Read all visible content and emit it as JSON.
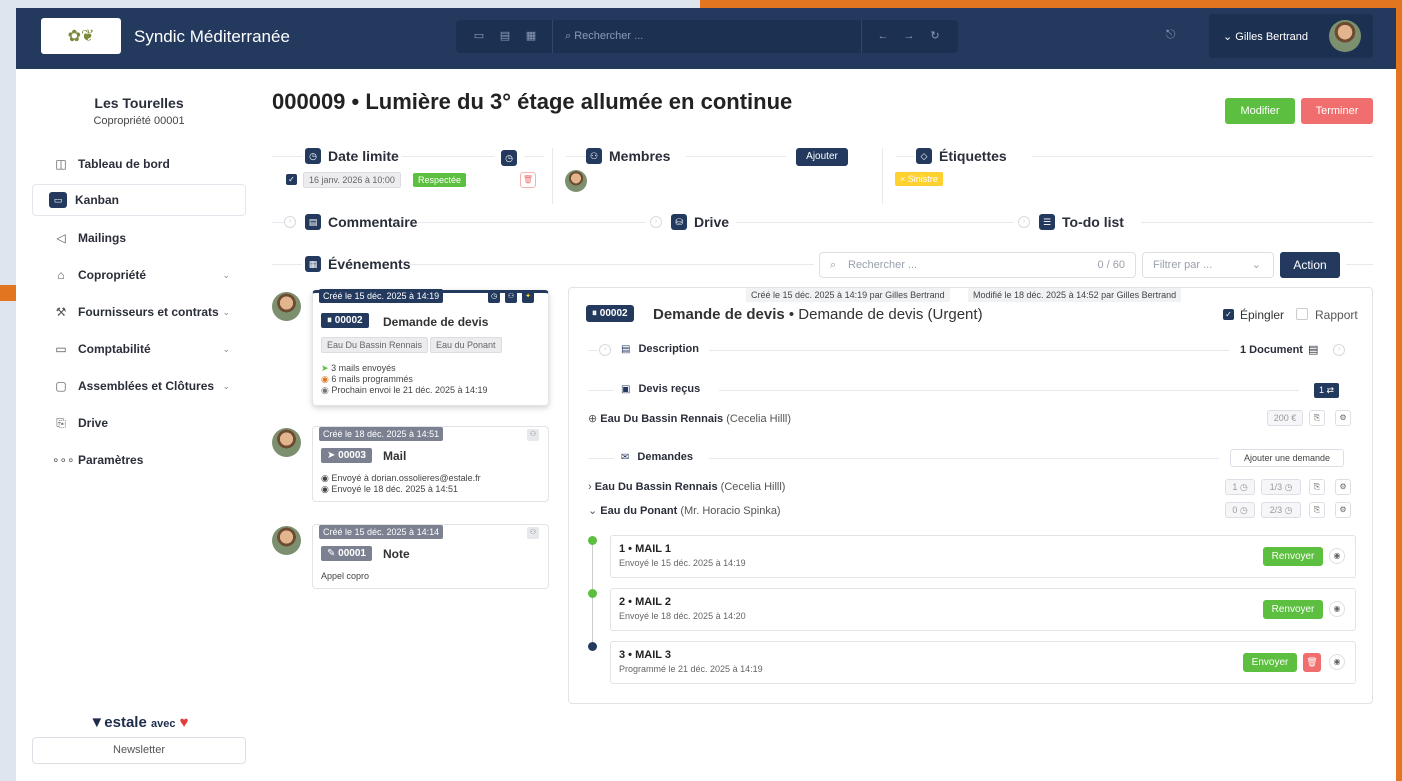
{
  "app": {
    "title": "Syndic Méditerranée",
    "search_placeholder": "Rechercher ...",
    "user_name": "Gilles Bertrand"
  },
  "sidebar": {
    "org_name": "Les Tourelles",
    "org_sub": "Copropriété 00001",
    "items": [
      {
        "label": "Tableau de bord"
      },
      {
        "label": "Kanban"
      },
      {
        "label": "Mailings"
      },
      {
        "label": "Copropriété"
      },
      {
        "label": "Fournisseurs et contrats"
      },
      {
        "label": "Comptabilité"
      },
      {
        "label": "Assemblées et Clôtures"
      },
      {
        "label": "Drive"
      },
      {
        "label": "Paramètres"
      }
    ],
    "brand": "estale",
    "brand_suffix": "avec",
    "newsletter": "Newsletter"
  },
  "page": {
    "title": "000009 • Lumière du 3° étage allumée en continue",
    "edit_button": "Modifier",
    "finish_button": "Terminer"
  },
  "sections": {
    "deadline": "Date limite",
    "deadline_value": "16 janv. 2026 à 10:00",
    "deadline_status": "Respectée",
    "members": "Membres",
    "add_member": "Ajouter",
    "labels": "Étiquettes",
    "label_tag": "Sinistre",
    "comment": "Commentaire",
    "drive": "Drive",
    "todo": "To-do list",
    "events": "Événements",
    "events_search": "Rechercher ...",
    "events_count": "0 / 60",
    "filter": "Filtrer par ...",
    "action": "Action"
  },
  "events": [
    {
      "date": "Créé le 15 déc. 2025 à 14:19",
      "id": "00002",
      "title": "Demande de devis",
      "tags": [
        "Eau Du Bassin Rennais",
        "Eau du Ponant"
      ],
      "lines": [
        "3 mails envoyés",
        "6 mails programmés",
        "Prochain envoi le 21 déc. 2025 à 14:19"
      ]
    },
    {
      "date": "Créé le 18 déc. 2025 à 14:51",
      "id": "00003",
      "title": "Mail",
      "lines": [
        "Envoyé à dorian.ossolieres@estale.fr",
        "Envoyé le 18 déc. 2025 à 14:51"
      ]
    },
    {
      "date": "Créé le 15 déc. 2025 à 14:14",
      "id": "00001",
      "title": "Note",
      "lines": [
        "Appel copro"
      ]
    }
  ],
  "detail": {
    "created": "Créé le 15 déc. 2025 à 14:19 par Gilles Bertrand",
    "modified": "Modifié le 18 déc. 2025 à 14:52 par Gilles Bertrand",
    "id": "00002",
    "title_bold": "Demande de devis",
    "title_rest": " • Demande de devis (Urgent)",
    "pin": "Épingler",
    "report": "Rapport",
    "description": "Description",
    "documents": "1 Document",
    "quotes": "Devis reçus",
    "quotes_count": "1",
    "quote_supplier": "Eau Du Bassin Rennais",
    "quote_contact": "(Cecelia Hilll)",
    "quote_amount": "200 €",
    "requests": "Demandes",
    "add_request": "Ajouter une demande",
    "req1_supplier": "Eau Du Bassin Rennais",
    "req1_contact": "(Cecelia Hilll)",
    "req1_a": "1",
    "req1_b": "1/3",
    "req2_supplier": "Eau du Ponant",
    "req2_contact": "(Mr. Horacio Spinka)",
    "req2_a": "0",
    "req2_b": "2/3",
    "mails": [
      {
        "title": "1 • MAIL 1",
        "sub": "Envoyé le 15 déc. 2025 à 14:19",
        "button": "Renvoyer"
      },
      {
        "title": "2 • MAIL 2",
        "sub": "Envoyé le 18 déc. 2025 à 14:20",
        "button": "Renvoyer"
      },
      {
        "title": "3 • MAIL 3",
        "sub": "Programmé le 21 déc. 2025 à 14:19",
        "button": "Envoyer"
      }
    ]
  },
  "colors": {
    "navy": "#233a5e",
    "green": "#5cbf3f",
    "red": "#f06e6e",
    "yellow": "#ffd12e",
    "orange": "#e2751f"
  }
}
